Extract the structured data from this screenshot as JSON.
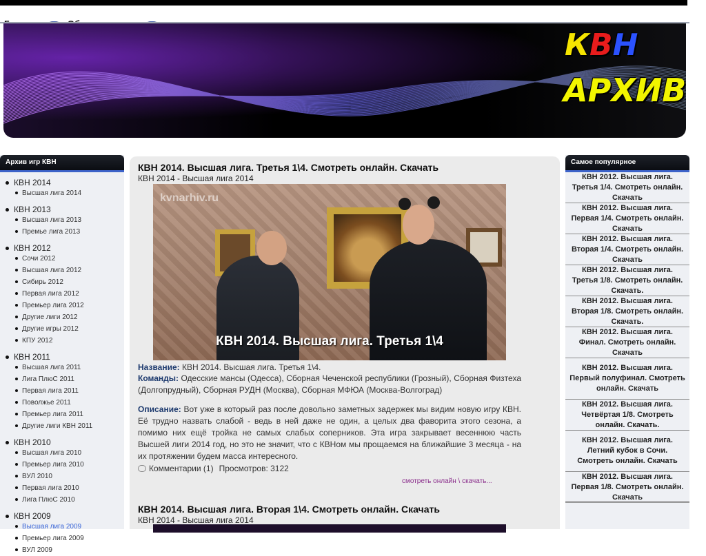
{
  "nav": {
    "home": "Главная",
    "feedback": "Обратная связь"
  },
  "banner": {
    "logo_line1": "КВН",
    "logo_line2": "АРХИВ"
  },
  "left_sidebar": {
    "title": "Архив игр КВН",
    "groups": [
      {
        "label": "КВН 2014",
        "items": [
          "Высшая лига 2014"
        ]
      },
      {
        "label": "КВН 2013",
        "items": [
          "Высшая лига 2013",
          "Премье лига 2013"
        ]
      },
      {
        "label": "КВН 2012",
        "items": [
          "Сочи 2012",
          "Высшая лига 2012",
          "Сибирь 2012",
          "Первая лига 2012",
          "Премьер лига 2012",
          "Другие лиги 2012",
          "Другие игры 2012",
          "КПУ 2012"
        ]
      },
      {
        "label": "КВН 2011",
        "items": [
          "Высшая лига 2011",
          "Лига ПлюС 2011",
          "Первая лига 2011",
          "Поволжье 2011",
          "Премьер лига 2011",
          "Другие лиги КВН 2011"
        ]
      },
      {
        "label": "КВН 2010",
        "items": [
          "Высшая лига 2010",
          "Премьер лига 2010",
          "ВУЛ 2010",
          "Первая лига 2010",
          "Лига ПлюС 2010"
        ]
      },
      {
        "label": "КВН 2009",
        "items": [
          "Высшая лига 2009",
          "Премьер лига 2009",
          "ВУЛ 2009"
        ]
      }
    ],
    "active_item": "Высшая лига 2009"
  },
  "post1": {
    "title": "КВН 2014. Высшая лига. Третья 1\\4. Смотреть онлайн. Скачать",
    "category": "КВН 2014 - Высшая лига 2014",
    "image_watermark": "kvnarhiv.ru",
    "image_caption": "КВН 2014. Высшая лига. Третья 1\\4",
    "name_label": "Название:",
    "name_value": "КВН 2014. Высшая лига. Третья 1\\4.",
    "teams_label": "Команды:",
    "teams_value": "Одесские мансы (Одесса), Сборная Чеченской республики (Грозный), Сборная Физтеха (Долгопрудный), Сборная РУДН (Москва), Сборная МФЮА (Москва-Волгоград)",
    "desc_label": "Описание:",
    "desc_value": "Вот уже в который раз после довольно заметных задержек мы видим новую игру КВН. Её трудно назвать слабой - ведь в ней даже не один, а целых два фаворита этого сезона, а помимо них ещё тройка не самых слабых соперников. Эта игра закрывает весеннюю часть Высшей лиги 2014 год, но это не значит, что с КВНом мы прощаемся на ближайшие 3 месяца - на их протяжении будем масса интересного.",
    "comments": "Комментарии (1)",
    "views": "Просмотров: 3122",
    "read_more": "смотреть онлайн \\ скачать..."
  },
  "post2": {
    "title": "КВН 2014. Высшая лига. Вторая 1\\4. Смотреть онлайн. Скачать",
    "category": "КВН 2014 - Высшая лига 2014"
  },
  "right_sidebar": {
    "title": "Самое популярное",
    "items": [
      "КВН 2012. Высшая лига. Третья 1/4. Смотреть онлайн. Скачать",
      "КВН 2012. Высшая лига. Первая 1/4. Смотреть онлайн. Скачать",
      "КВН 2012. Высшая лига. Вторая 1/4. Смотреть онлайн. Скачать",
      "КВН 2012. Высшая лига. Третья 1/8. Смотреть онлайн. Скачать.",
      "КВН 2012. Высшая лига. Вторая 1/8. Смотреть онлайн. Скачать.",
      "КВН 2012. Высшая лига. Финал. Смотреть онлайн. Скачать",
      "КВН 2012. Высшая лига. Первый полуфинал. Смотреть онлайн. Скачать",
      "КВН 2012. Высшая лига. Четвёртая 1/8. Смотреть онлайн. Скачать.",
      "КВН 2012. Высшая лига. Летний кубок в Сочи. Смотреть онлайн. Скачать",
      "КВН 2012. Высшая лига. Первая 1/8. Смотреть онлайн. Скачать"
    ]
  }
}
